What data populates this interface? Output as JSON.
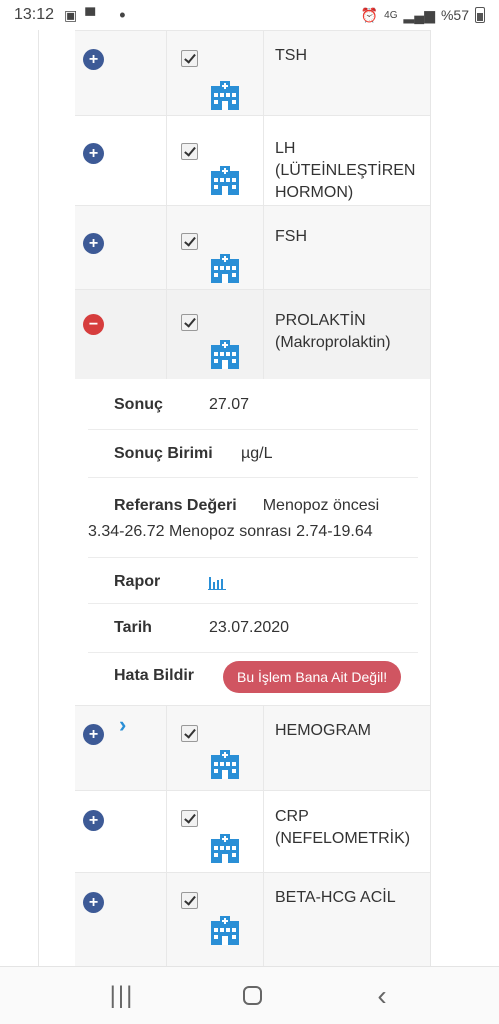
{
  "status": {
    "time": "13:12",
    "network": "4G",
    "battery": "%57"
  },
  "tests": [
    {
      "name": "TSH",
      "expanded": false,
      "checked": true
    },
    {
      "name": "LH (LÜTEİNLEŞTİREN HORMON)",
      "expanded": false,
      "checked": true
    },
    {
      "name": "FSH",
      "expanded": false,
      "checked": true
    },
    {
      "name": "PROLAKTİN (Makroprolaktin)",
      "expanded": true,
      "checked": true
    },
    {
      "name": "HEMOGRAM",
      "expanded": false,
      "checked": true
    },
    {
      "name": "CRP (NEFELOMETRİK)",
      "expanded": false,
      "checked": true
    },
    {
      "name": "BETA-HCG ACİL",
      "expanded": false,
      "checked": true
    }
  ],
  "detail": {
    "result_label": "Sonuç",
    "result_value": "27.07",
    "unit_label": "Sonuç Birimi",
    "unit_value": "µg/L",
    "reference_label": "Referans Değeri",
    "reference_value_line1": "Menopoz öncesi",
    "reference_value_line2": "3.34-26.72 Menopoz sonrası 2.74-19.64",
    "report_label": "Rapor",
    "date_label": "Tarih",
    "date_value": "23.07.2020",
    "error_label": "Hata Bildir",
    "error_button": "Bu İşlem Bana Ait Değil!"
  },
  "colors": {
    "plus_button": "#3d5a96",
    "minus_button": "#d63d3d",
    "hospital_icon": "#2a8fd6",
    "error_button": "#d05561"
  },
  "icons": {
    "toggle_expand": "plus-circle-icon",
    "toggle_collapse": "minus-circle-icon",
    "hospital": "hospital-icon",
    "report": "bar-chart-icon"
  }
}
